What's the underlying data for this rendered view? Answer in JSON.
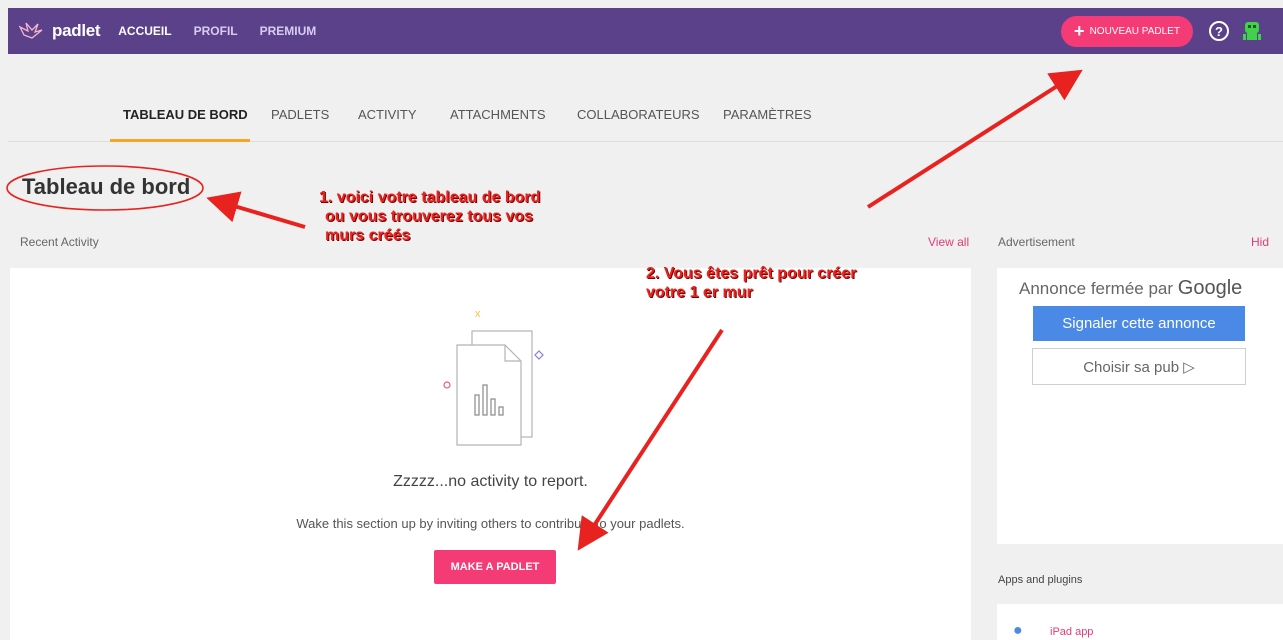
{
  "header": {
    "logo_text": "padlet",
    "nav": [
      "ACCUEIL",
      "PROFIL",
      "PREMIUM"
    ],
    "new_padlet_label": "NOUVEAU PADLET",
    "help_label": "?"
  },
  "tabs": [
    "TABLEAU DE BORD",
    "PADLETS",
    "ACTIVITY",
    "ATTACHMENTS",
    "COLLABORATEURS",
    "PARAMÈTRES"
  ],
  "page_title": "Tableau de bord",
  "recent_activity": {
    "label": "Recent Activity",
    "view_all": "View all",
    "empty_title": "Zzzzz...no activity to report.",
    "empty_desc": "Wake this section up by inviting others to contribute to your padlets.",
    "make_button": "MAKE A PADLET"
  },
  "advertisement": {
    "label": "Advertisement",
    "hide": "Hid",
    "closed_text": "Annonce fermée par",
    "google": "Google",
    "report_button": "Signaler cette annonce",
    "choose_button": "Choisir sa pub ▷"
  },
  "apps": {
    "label": "Apps and plugins",
    "ipad": "iPad app"
  },
  "annotations": {
    "note1": [
      "1. voici votre tableau de bord",
      "ou vous trouverez tous vos",
      "murs créés"
    ],
    "note2": [
      "2.  Vous êtes prêt pour créer",
      "votre 1 er mur"
    ]
  },
  "colors": {
    "header_bg": "#5a4189",
    "accent_pink": "#f43b76",
    "tab_underline": "#f5a623",
    "annotation_red": "#e8231f",
    "google_blue": "#4a8ae6"
  }
}
